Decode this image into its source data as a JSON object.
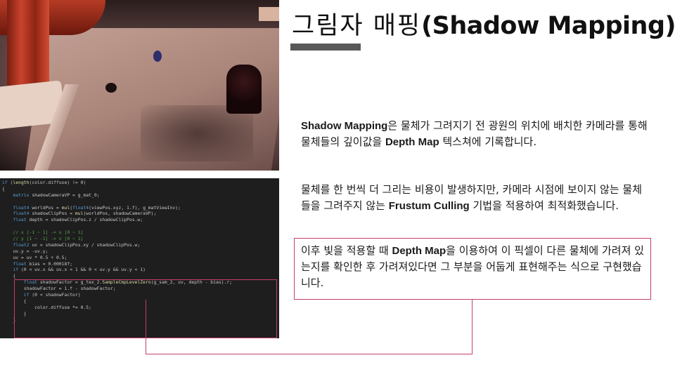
{
  "title": {
    "korean": "그림자 매핑",
    "english": "(Shadow Mapping)"
  },
  "paragraph1": {
    "term1": "Shadow Mapping",
    "text1": "은 물체가 그려지기 전 광원의 위치에 배치한 카메라를 통해 물체들의 깊이값을 ",
    "term2": "Depth Map",
    "text2": " 텍스쳐에 기록합니다."
  },
  "paragraph2": {
    "text1": "물체를 한 번씩 더 그리는 비용이 발생하지만, 카메라 시점에 보이지 않는 물체들을 그려주지 않는 ",
    "term1": "Frustum Culling",
    "text2": " 기법을 적용하여 최적화했습니다."
  },
  "paragraph3": {
    "text1": "이후 빛을 적용할 때 ",
    "term1": "Depth Map",
    "text2": "을 이용하여 이 픽셀이 다른 물체에 가려져 있는지를 확인한 후 가려져있다면 그 부분을 어둡게 표현해주는 식으로 구현했습니다."
  },
  "code_lines": [
    "if (length(color.diffuse) != 0)",
    "{",
    "    matrix shadowCameraVP = g_mat_0;",
    "",
    "    float4 worldPos = mul(float4(viewPos.xyz, 1.f), g_matViewInv);",
    "    float4 shadowClipPos = mul(worldPos, shadowCameraVP);",
    "    float depth = shadowClipPos.z / shadowClipPos.w;",
    "",
    "    // x [-1 ~ 1] -> u [0 ~ 1]",
    "    // y [1 ~ -1] -> v [0 ~ 1]",
    "    float2 uv = shadowClipPos.xy / shadowClipPos.w;",
    "    uv.y = -uv.y;",
    "    uv = uv * 0.5 + 0.5;",
    "    float bias = 0.00018f;",
    "    if (0 < uv.x && uv.x < 1 && 0 < uv.y && uv.y < 1)",
    "    {",
    "        float shadowFactor = g_tex_2.SampleCmpLevelZero(g_sam_2, uv, depth - bias).r;",
    "        shadowFactor = 1.f - shadowFactor;",
    "        if (0 < shadowFactor)",
    "        {",
    "            color.diffuse *= 0.5;",
    "        }",
    "    }"
  ]
}
